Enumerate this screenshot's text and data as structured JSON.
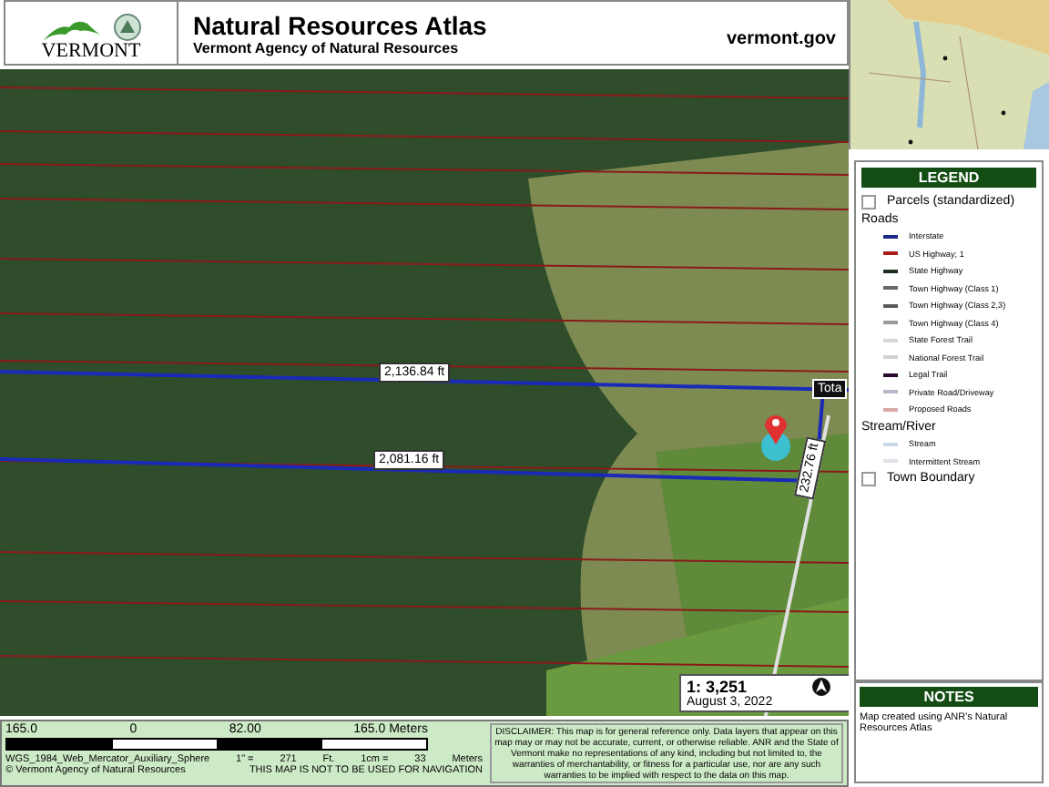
{
  "header": {
    "logo_text": "VERMONT",
    "title": "Natural Resources Atlas",
    "subtitle": "Vermont Agency of Natural Resources",
    "site": "vermont.gov"
  },
  "map": {
    "measurements": [
      {
        "kind": "horizontal",
        "label": "2,136.84 ft"
      },
      {
        "kind": "horizontal",
        "label": "2,081.16 ft"
      },
      {
        "kind": "vertical",
        "label": "232.76 ft"
      },
      {
        "kind": "total",
        "label": "Tota"
      }
    ],
    "scale": "1: 3,251",
    "date": "August 3, 2022"
  },
  "legend": {
    "title": "LEGEND",
    "items": [
      {
        "kind": "box",
        "label": "Parcels (standardized)",
        "checked": false
      },
      {
        "kind": "heading",
        "label": "Roads"
      },
      {
        "kind": "line",
        "label": "Interstate",
        "color": "#1c2a8a"
      },
      {
        "kind": "line",
        "label": "US Highway; 1",
        "color": "#a81c1c"
      },
      {
        "kind": "line",
        "label": "State Highway",
        "color": "#1e2e1e"
      },
      {
        "kind": "line",
        "label": "Town Highway (Class 1)",
        "color": "#6a6a6a"
      },
      {
        "kind": "line",
        "label": "Town Highway (Class 2,3)",
        "color": "#5a5a5a"
      },
      {
        "kind": "line",
        "label": "Town Highway (Class 4)",
        "color": "#9a9a9a"
      },
      {
        "kind": "line",
        "label": "State Forest Trail",
        "color": "#d8d8d8"
      },
      {
        "kind": "line",
        "label": "National Forest Trail",
        "color": "#d0d0d0"
      },
      {
        "kind": "line",
        "label": "Legal Trail",
        "color": "#2a0a2a"
      },
      {
        "kind": "line",
        "label": "Private Road/Driveway",
        "color": "#b8b8c8"
      },
      {
        "kind": "line",
        "label": "Proposed Roads",
        "color": "#d8a8a8"
      },
      {
        "kind": "heading",
        "label": "Stream/River"
      },
      {
        "kind": "line",
        "label": "Stream",
        "color": "#c8d8e8"
      },
      {
        "kind": "line",
        "label": "Intermittent Stream",
        "color": "#e0e0e8"
      },
      {
        "kind": "box",
        "label": "Town Boundary",
        "checked": false
      }
    ]
  },
  "footer": {
    "scale_labels": [
      "165.0",
      "0",
      "82.00",
      "165.0 Meters"
    ],
    "projection": "WGS_1984_Web_Mercator_Auxiliary_Sphere",
    "inch_ratio": [
      "1\" =",
      "271",
      "Ft."
    ],
    "cm_ratio": [
      "1cm =",
      "33",
      "Meters"
    ],
    "copyright": "© Vermont Agency of Natural Resources",
    "warning": "THIS MAP IS NOT TO BE USED FOR NAVIGATION",
    "disclaimer": "DISCLAIMER: This map is for general reference only. Data layers that appear on this map may or may not be accurate, current, or otherwise reliable. ANR and the State of Vermont make no representations of any kind, including but not limited to, the warranties of merchantability, or fitness for a particular use, nor are any such warranties to be implied with respect to the data on this map."
  },
  "notes": {
    "title": "NOTES",
    "text": "Map created using ANR's Natural Resources Atlas"
  }
}
